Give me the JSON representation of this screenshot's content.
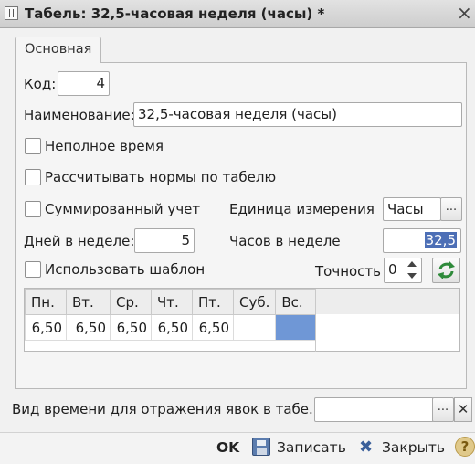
{
  "window": {
    "title": "Табель: 32,5-часовая неделя (часы) *",
    "close": "×"
  },
  "tabs": [
    {
      "label": "Основная"
    }
  ],
  "form": {
    "kod_label": "Код:",
    "kod_value": "4",
    "name_label": "Наименование:",
    "name_value": "32,5-часовая неделя (часы)",
    "partial_time_label": "Неполное время",
    "calc_norms_label": "Рассчитывать нормы по табелю",
    "summarized_label": "Суммированный учет",
    "unit_label": "Единица измерения",
    "unit_value": "Часы",
    "days_label": "Дней в неделе:",
    "days_value": "5",
    "hours_label": "Часов в неделе",
    "hours_value": "32,5",
    "template_label": "Использовать шаблон",
    "precision_label": "Точность",
    "precision_value": "0"
  },
  "grid": {
    "headers": [
      "Пн.",
      "Вт.",
      "Ср.",
      "Чт.",
      "Пт.",
      "Суб.",
      "Вс."
    ],
    "row": [
      "6,50",
      "6,50",
      "6,50",
      "6,50",
      "6,50",
      "",
      ""
    ]
  },
  "bottom": {
    "time_type_label": "Вид времени для отражения явок в табе..",
    "time_type_value": ""
  },
  "footer": {
    "ok": "OK",
    "save": "Записать",
    "close": "Закрыть",
    "help": "?"
  },
  "colors": {
    "selection": "#4d6fb6",
    "grid_highlight": "#6f97d6"
  }
}
